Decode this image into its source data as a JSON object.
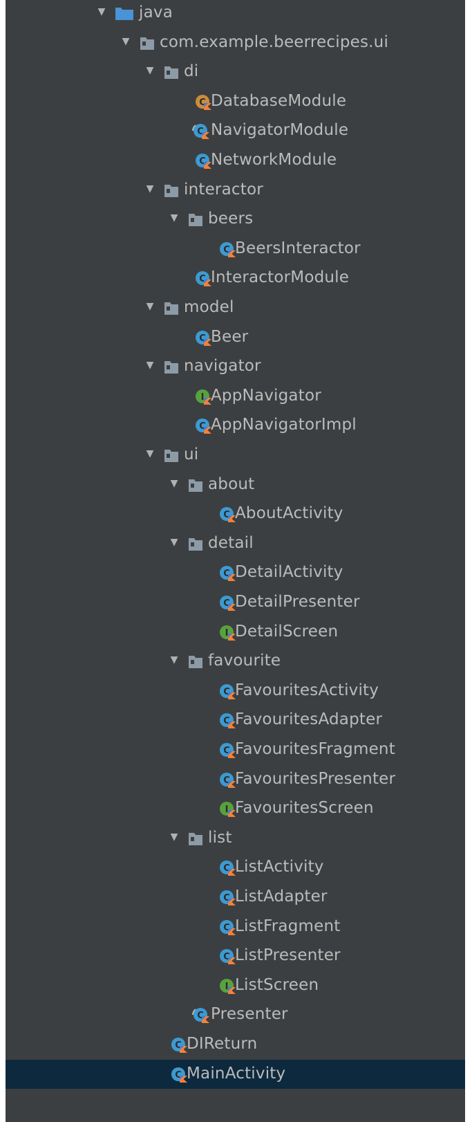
{
  "colors": {
    "background": "#3c3f41",
    "selected_row": "#0d293e",
    "text": "#bbbbbb",
    "arrow": "#afb1b3",
    "folder": "#8d9ba7",
    "source_folder": "#4a93d6",
    "class_icon": "#3d9ad1",
    "interface_icon": "#58a23e",
    "object_icon": "#c98d3c",
    "kotlin_badge": "#f2823a",
    "kotlin_badge_alt": "#3c7ddc"
  },
  "tree": {
    "nodes": [
      {
        "label": "java",
        "depth": 0,
        "kind": "source-folder",
        "expanded": true
      },
      {
        "label": "com.example.beerrecipes.ui",
        "depth": 1,
        "kind": "package",
        "expanded": true
      },
      {
        "label": "di",
        "depth": 2,
        "kind": "package",
        "expanded": true
      },
      {
        "label": "DatabaseModule",
        "depth": 3,
        "kind": "object"
      },
      {
        "label": "NavigatorModule",
        "depth": 3,
        "kind": "abstract-class"
      },
      {
        "label": "NetworkModule",
        "depth": 3,
        "kind": "class"
      },
      {
        "label": "interactor",
        "depth": 2,
        "kind": "package",
        "expanded": true
      },
      {
        "label": "beers",
        "depth": 3,
        "kind": "package",
        "expanded": true
      },
      {
        "label": "BeersInteractor",
        "depth": 4,
        "kind": "class"
      },
      {
        "label": "InteractorModule",
        "depth": 3,
        "kind": "class"
      },
      {
        "label": "model",
        "depth": 2,
        "kind": "package",
        "expanded": true
      },
      {
        "label": "Beer",
        "depth": 3,
        "kind": "class"
      },
      {
        "label": "navigator",
        "depth": 2,
        "kind": "package",
        "expanded": true
      },
      {
        "label": "AppNavigator",
        "depth": 3,
        "kind": "interface"
      },
      {
        "label": "AppNavigatorImpl",
        "depth": 3,
        "kind": "class"
      },
      {
        "label": "ui",
        "depth": 2,
        "kind": "package",
        "expanded": true
      },
      {
        "label": "about",
        "depth": 3,
        "kind": "package",
        "expanded": true
      },
      {
        "label": "AboutActivity",
        "depth": 4,
        "kind": "class"
      },
      {
        "label": "detail",
        "depth": 3,
        "kind": "package",
        "expanded": true
      },
      {
        "label": "DetailActivity",
        "depth": 4,
        "kind": "class"
      },
      {
        "label": "DetailPresenter",
        "depth": 4,
        "kind": "class"
      },
      {
        "label": "DetailScreen",
        "depth": 4,
        "kind": "interface"
      },
      {
        "label": "favourite",
        "depth": 3,
        "kind": "package",
        "expanded": true
      },
      {
        "label": "FavouritesActivity",
        "depth": 4,
        "kind": "class"
      },
      {
        "label": "FavouritesAdapter",
        "depth": 4,
        "kind": "class"
      },
      {
        "label": "FavouritesFragment",
        "depth": 4,
        "kind": "class"
      },
      {
        "label": "FavouritesPresenter",
        "depth": 4,
        "kind": "class"
      },
      {
        "label": "FavouritesScreen",
        "depth": 4,
        "kind": "interface"
      },
      {
        "label": "list",
        "depth": 3,
        "kind": "package",
        "expanded": true
      },
      {
        "label": "ListActivity",
        "depth": 4,
        "kind": "class"
      },
      {
        "label": "ListAdapter",
        "depth": 4,
        "kind": "class"
      },
      {
        "label": "ListFragment",
        "depth": 4,
        "kind": "class"
      },
      {
        "label": "ListPresenter",
        "depth": 4,
        "kind": "class"
      },
      {
        "label": "ListScreen",
        "depth": 4,
        "kind": "interface"
      },
      {
        "label": "Presenter",
        "depth": 3,
        "kind": "abstract-class"
      },
      {
        "label": "DIReturn",
        "depth": 2,
        "kind": "class"
      },
      {
        "label": "MainActivity",
        "depth": 2,
        "kind": "class",
        "selected": true
      }
    ]
  }
}
